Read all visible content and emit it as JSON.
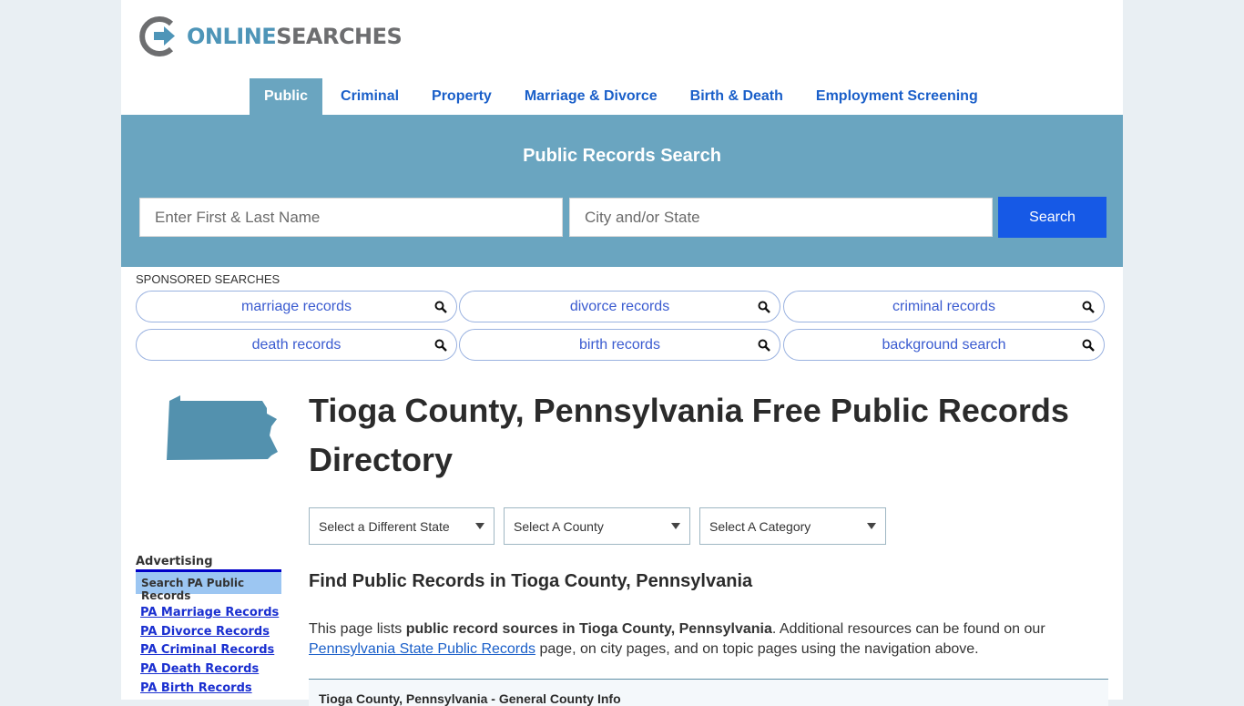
{
  "logo": {
    "part1": "ONLINE",
    "part2": "SEARCHES",
    "colors": {
      "blue": "#4e95b8",
      "gray": "#6d6e70"
    }
  },
  "nav": {
    "items": [
      {
        "label": "Public",
        "active": true
      },
      {
        "label": "Criminal"
      },
      {
        "label": "Property"
      },
      {
        "label": "Marriage & Divorce"
      },
      {
        "label": "Birth & Death"
      },
      {
        "label": "Employment Screening"
      }
    ]
  },
  "search": {
    "title": "Public Records Search",
    "name_placeholder": "Enter First & Last Name",
    "location_placeholder": "City and/or State",
    "button_label": "Search",
    "band_color": "#6aa5c0",
    "button_color": "#1659e6"
  },
  "sponsored": {
    "label": "SPONSORED SEARCHES",
    "items": [
      "marriage records",
      "divorce records",
      "criminal records",
      "death records",
      "birth records",
      "background search"
    ],
    "icon": "search-icon"
  },
  "sidebar": {
    "map_icon": "pennsylvania-map-icon",
    "advertising_label": "Advertising",
    "ad_header": "Search PA Public Records",
    "links": [
      "PA Marriage Records",
      "PA Divorce Records",
      "PA Criminal Records",
      "PA Death Records",
      "PA Birth Records"
    ]
  },
  "main": {
    "title": "Tioga County, Pennsylvania Free Public Records Directory",
    "selects": [
      {
        "value": "Select a Different State"
      },
      {
        "value": "Select A County"
      },
      {
        "value": "Select A Category"
      }
    ],
    "subtitle": "Find Public Records in Tioga County, Pennsylvania",
    "intro": {
      "text1": "This page lists ",
      "bold": "public record sources in Tioga County, Pennsylvania",
      "text2": ". Additional resources can be found on our ",
      "link": "Pennsylvania State Public Records",
      "text3": " page, on city pages, and on topic pages using the navigation above."
    },
    "info_box_title": "Tioga County, Pennsylvania - General County Info"
  }
}
